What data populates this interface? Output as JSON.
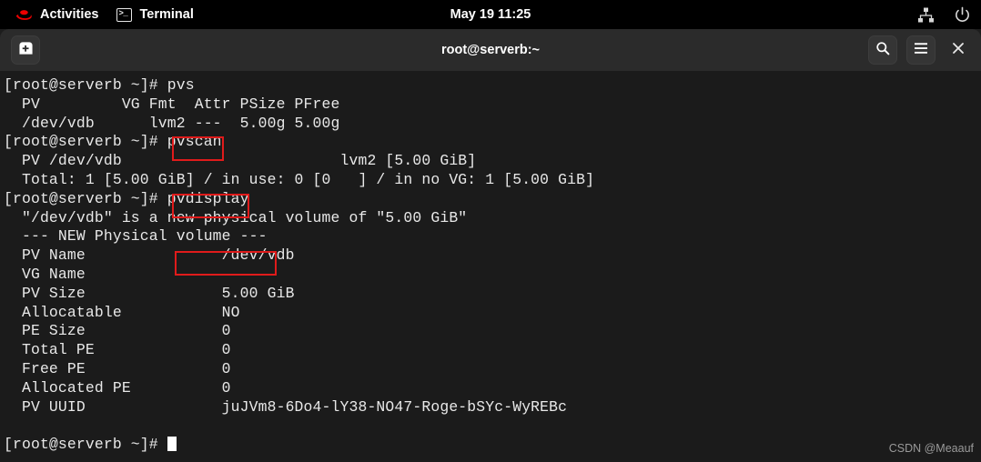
{
  "topbar": {
    "activities_label": "Activities",
    "app_label": "Terminal",
    "clock": "May 19  11:25",
    "logo_icon": "redhat-logo-icon",
    "app_icon": "terminal-icon",
    "network_icon": "network-wired-icon",
    "power_icon": "power-icon"
  },
  "window": {
    "title": "root@serverb:~",
    "new_tab_icon": "new-terminal-icon",
    "search_icon": "search-icon",
    "menu_icon": "hamburger-menu-icon",
    "close_icon": "close-icon"
  },
  "terminal": {
    "prompt": "[root@serverb ~]# ",
    "cursor_visible": true,
    "highlight_color": "#e01b1b",
    "lines": [
      "[root@serverb ~]# pvs",
      "  PV         VG Fmt  Attr PSize PFree",
      "  /dev/vdb      lvm2 ---  5.00g 5.00g",
      "[root@serverb ~]# pvscan",
      "  PV /dev/vdb                        lvm2 [5.00 GiB]",
      "  Total: 1 [5.00 GiB] / in use: 0 [0   ] / in no VG: 1 [5.00 GiB]",
      "[root@serverb ~]# pvdisplay",
      "  \"/dev/vdb\" is a new physical volume of \"5.00 GiB\"",
      "  --- NEW Physical volume ---",
      "  PV Name               /dev/vdb",
      "  VG Name               ",
      "  PV Size               5.00 GiB",
      "  Allocatable           NO",
      "  PE Size               0",
      "  Total PE              0",
      "  Free PE               0",
      "  Allocated PE          0",
      "  PV UUID               juJVm8-6Do4-lY38-NO47-Roge-bSYc-WyREBc",
      "",
      "[root@serverb ~]# "
    ],
    "highlighted_commands": [
      "pvs",
      "pvscan",
      "pvdisplay"
    ]
  },
  "watermark": "CSDN @Meaauf"
}
